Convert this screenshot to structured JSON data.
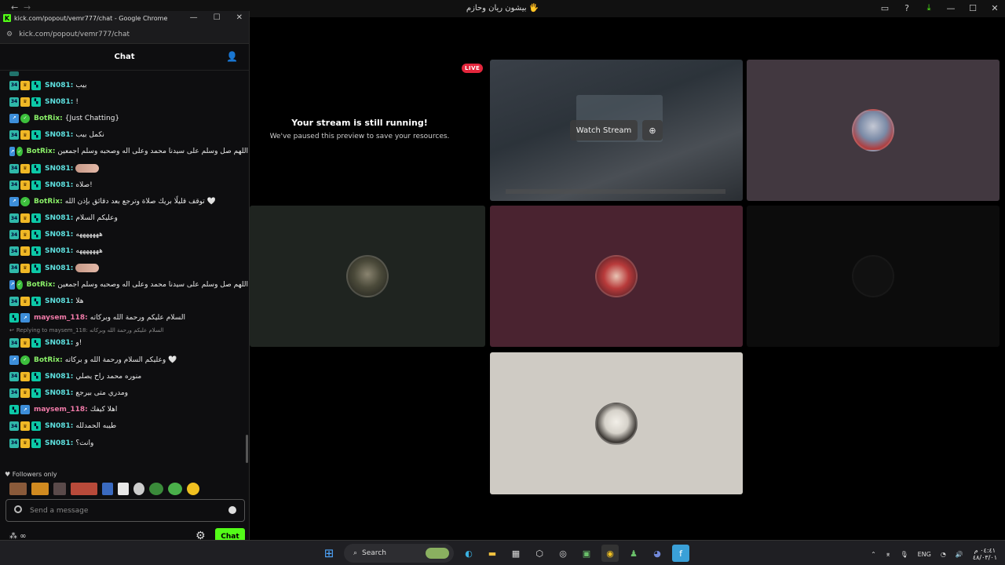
{
  "main_window": {
    "title": "بيشون ريان وحازم 🖐"
  },
  "chat_window": {
    "title": "kick.com/popout/vemr777/chat - Google Chrome",
    "url": "kick.com/popout/vemr777/chat",
    "header_title": "Chat"
  },
  "messages": [
    {
      "user": "SN081:",
      "text": "بيب",
      "type": "sn"
    },
    {
      "user": "SN081:",
      "text": "!",
      "type": "sn"
    },
    {
      "user": "BotRix:",
      "text": "{Just Chatting}",
      "type": "bot"
    },
    {
      "user": "SN081:",
      "text": "نكمل بيب",
      "type": "sn"
    },
    {
      "user": "BotRix:",
      "text": "اللهم صل وسلم على سيدنا محمد وعلى اله وصحبه وسلم اجمعين",
      "type": "bot"
    },
    {
      "user": "SN081:",
      "text": "",
      "type": "sn",
      "emote": true
    },
    {
      "user": "SN081:",
      "text": "صلاه!",
      "type": "sn"
    },
    {
      "user": "BotRix:",
      "text": "توقف قليلًا بريك صلاة وترجع بعد دقائق بإذن الله 🤍",
      "type": "bot"
    },
    {
      "user": "SN081:",
      "text": "وعليكم السلام",
      "type": "sn"
    },
    {
      "user": "SN081:",
      "text": "هههههههه",
      "type": "sn"
    },
    {
      "user": "SN081:",
      "text": "هههههههه",
      "type": "sn"
    },
    {
      "user": "SN081:",
      "text": "",
      "type": "sn",
      "emote": true
    },
    {
      "user": "BotRix:",
      "text": "اللهم صل وسلم على سيدنا محمد وعلى اله وصحبه وسلم اجمعين",
      "type": "bot"
    },
    {
      "user": "SN081:",
      "text": "هلا",
      "type": "sn"
    },
    {
      "user": "maysem_118:",
      "text": "السلام عليكم ورحمة الله وبركاته",
      "type": "may"
    }
  ],
  "reply_line": "Replying to maysem_118: السلام عليكم ورحمة الله وبركاته",
  "messages2": [
    {
      "user": "SN081:",
      "text": "و!",
      "type": "sn"
    },
    {
      "user": "BotRix:",
      "text": "وعليكم السلام ورحمة الله و بركاته 🤍",
      "type": "bot"
    },
    {
      "user": "SN081:",
      "text": "منوره محمد راح يصلي",
      "type": "sn"
    },
    {
      "user": "SN081:",
      "text": "ومدري متى بيرجع",
      "type": "sn"
    },
    {
      "user": "maysem_118:",
      "text": "اهلا كيفك",
      "type": "may"
    },
    {
      "user": "SN081:",
      "text": "طيبه الحمدلله",
      "type": "sn"
    },
    {
      "user": "SN081:",
      "text": "وانت؟",
      "type": "sn"
    }
  ],
  "followers_only": "Followers only",
  "message_placeholder": "Send a message",
  "chat_button": "Chat",
  "badge_sub_label": "34",
  "stage": {
    "live_badge": "LIVE",
    "stream_title": "Your stream is still running!",
    "stream_subtitle": "We've paused this preview to save your resources.",
    "watch_button": "Watch Stream"
  },
  "taskbar": {
    "search_label": "Search",
    "lang": "ENG",
    "time": "٠٤:٤١ م",
    "date": "٤٨/٠٣/٠١"
  },
  "colors": {
    "kick_green": "#53fc18",
    "sn_name": "#5ee0df",
    "bot_name": "#8af068",
    "may_name": "#f07aa8",
    "live_red": "#e3263c"
  }
}
